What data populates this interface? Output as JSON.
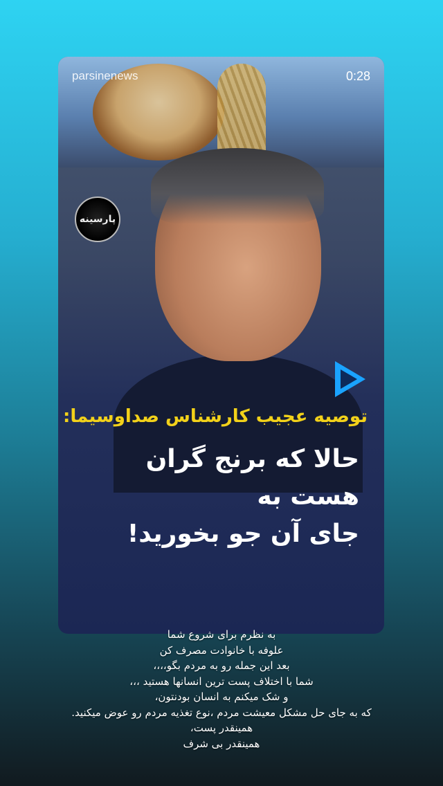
{
  "story": {
    "account": "parsinenews",
    "timer": "0:28",
    "logo_text": "پارسینه",
    "tag_line": "توصیه عجیب کارشناس صداوسیما:",
    "headline_lines": [
      "حالا که برنج گران هست به",
      "جای آن جو بخورید!"
    ],
    "caption_lines": [
      "به نظرم برای شروع شما",
      "علوفه با خانوادت مصرف کن",
      "بعد این جمله رو به مردم بگو،،،،",
      "شما با اختلاف پست ترین انسانها هستید ،،،",
      "و شک میکنم به انسان بودنتون،",
      "که به جای حل مشکل معیشت مردم ،نوع تغذیه مردم رو عوض میکنید.",
      "همینقدر پست،",
      "همینقدر بی شرف"
    ],
    "colors": {
      "accent_yellow": "#f2d11a",
      "play_blue": "#1aa3ff"
    }
  }
}
